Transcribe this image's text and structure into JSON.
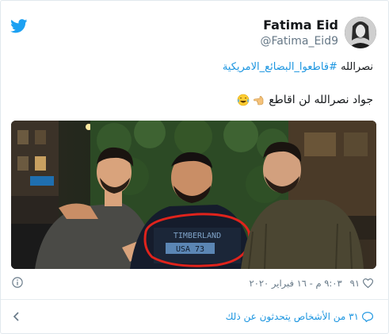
{
  "author": {
    "name": "Fatima Eid",
    "handle": "@Fatima_Eid9"
  },
  "tweet": {
    "line1_prefix": "نصرالله ",
    "hashtag": "#قاطعوا_البضائع_الامريكية",
    "line2_text": "جواد نصرالله لن اقاطع",
    "line2_emojis": [
      "finger-pointing-left-emoji",
      "laughing-tears-emoji"
    ]
  },
  "photo": {
    "shirt_brand": "TIMBERLAND",
    "shirt_text": "USA 73",
    "highlight_color": "#e0231c"
  },
  "meta": {
    "likes": "٩١",
    "timestamp": "٩:٠٣ م - ١٦ فبراير ٢٠٢٠"
  },
  "footer": {
    "people_talking": "٣١ من الأشخاص يتحدثون عن ذلك"
  },
  "colors": {
    "twitter_blue": "#1da1f2",
    "link_blue": "#1b95e0",
    "text_gray": "#657786"
  }
}
